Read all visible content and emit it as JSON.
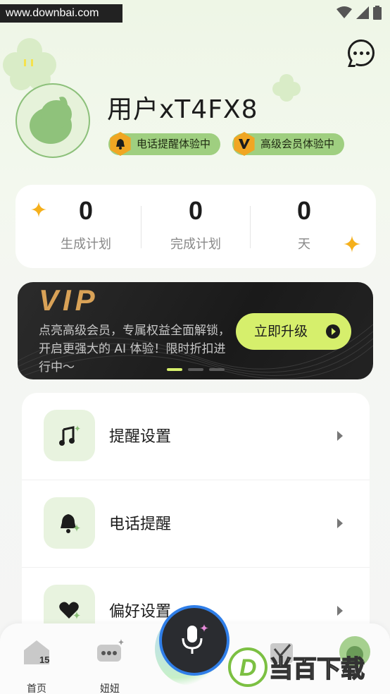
{
  "watermark": {
    "site": "www.downbai.com",
    "logo_text": "当百下载",
    "logo_letter": "D"
  },
  "profile": {
    "username": "用户xT4FX8",
    "badges": [
      {
        "label": "电话提醒体验中",
        "icon": "bell-icon"
      },
      {
        "label": "高级会员体验中",
        "icon": "v-icon"
      }
    ]
  },
  "stats": [
    {
      "value": "0",
      "label": "生成计划"
    },
    {
      "value": "0",
      "label": "完成计划"
    },
    {
      "value": "0",
      "label": "天"
    }
  ],
  "vip": {
    "title": "VIP",
    "description": "点亮高级会员，专属权益全面解锁，开启更强大的 AI 体验！限时折扣进行中～",
    "button": "立即升级",
    "pages": 3,
    "active_page": 1
  },
  "menu": [
    {
      "label": "提醒设置",
      "icon": "music-note-icon"
    },
    {
      "label": "电话提醒",
      "icon": "bell-icon"
    },
    {
      "label": "偏好设置",
      "icon": "heart-icon"
    }
  ],
  "tabs": [
    {
      "label": "首页",
      "icon": "home-icon"
    },
    {
      "label": "妞妞",
      "icon": "chat-icon"
    },
    {
      "label": "",
      "icon": "calendar-icon"
    },
    {
      "label": "",
      "icon": "avatar-icon"
    }
  ],
  "colors": {
    "accent": "#d6ef6c",
    "badge": "#9fcf80",
    "gold": "#f0a623",
    "mic_ring": "#2f7ee8"
  }
}
